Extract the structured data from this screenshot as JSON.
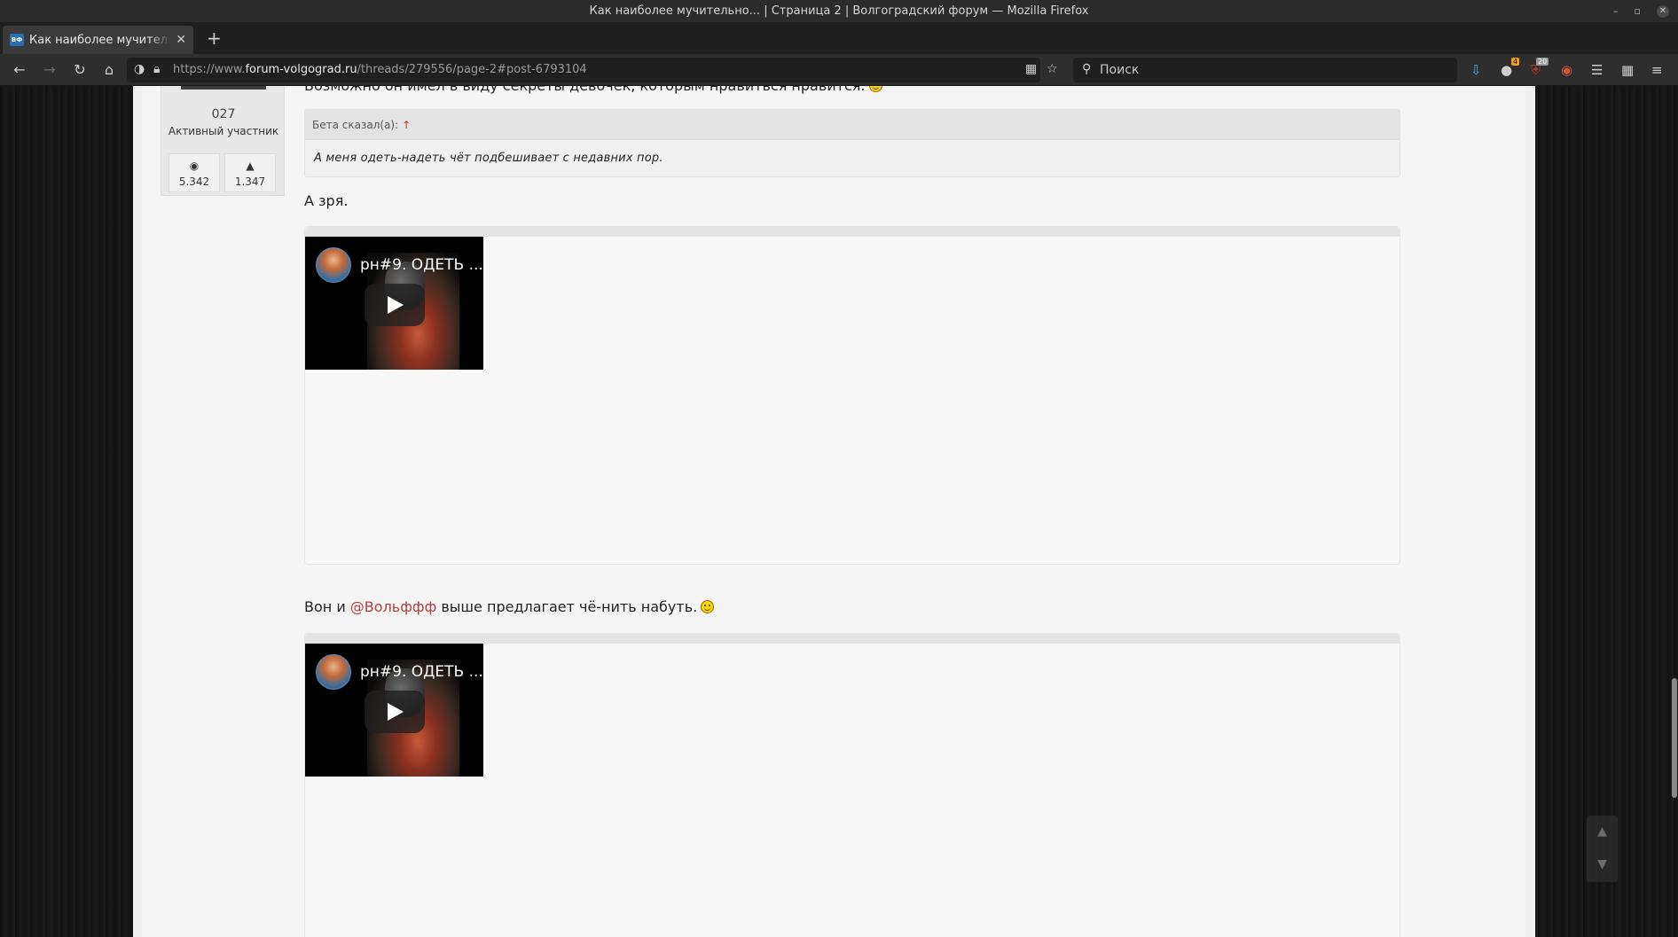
{
  "window": {
    "title": "Как наиболее мучительно... | Страница 2 | Волгоградский форум — Mozilla Firefox",
    "controls": [
      "minimize",
      "restore",
      "close"
    ]
  },
  "tabs": [
    {
      "title": "Как наиболее мучительно",
      "favicon_text": "ВФ",
      "active": true
    }
  ],
  "new_tab_label": "+",
  "url": {
    "prefix": "https://www.",
    "domain": "forum-volgograd.ru",
    "path": "/threads/279556/page-2#post-6793104"
  },
  "search": {
    "placeholder": "Поиск"
  },
  "toolbar_badges": {
    "extension_a": "4",
    "extension_b": "20"
  },
  "user": {
    "id_label": "027",
    "rank": "Активный участник",
    "messages_count": "5.342",
    "likes_count": "1.347"
  },
  "post": {
    "cut_line": "Возможно он имел в виду секреты девочек, которым нравиться нравится.",
    "quote": {
      "author_label": "Бета сказал(а):",
      "arrow": "↑",
      "text": "А меня одеть-надеть чёт подбешивает с недавних пор."
    },
    "reply1": "А зря.",
    "reply2": {
      "before": "Вон и ",
      "mention": "@Вольффф",
      "after": " выше предлагает чё-нить набуть."
    },
    "videos": [
      {
        "title": "рн#9. ОДЕТЬ ..."
      },
      {
        "title": "рн#9. ОДЕТЬ ..."
      }
    ]
  },
  "scroll_controls": {
    "up": "▲",
    "down": "▼"
  }
}
